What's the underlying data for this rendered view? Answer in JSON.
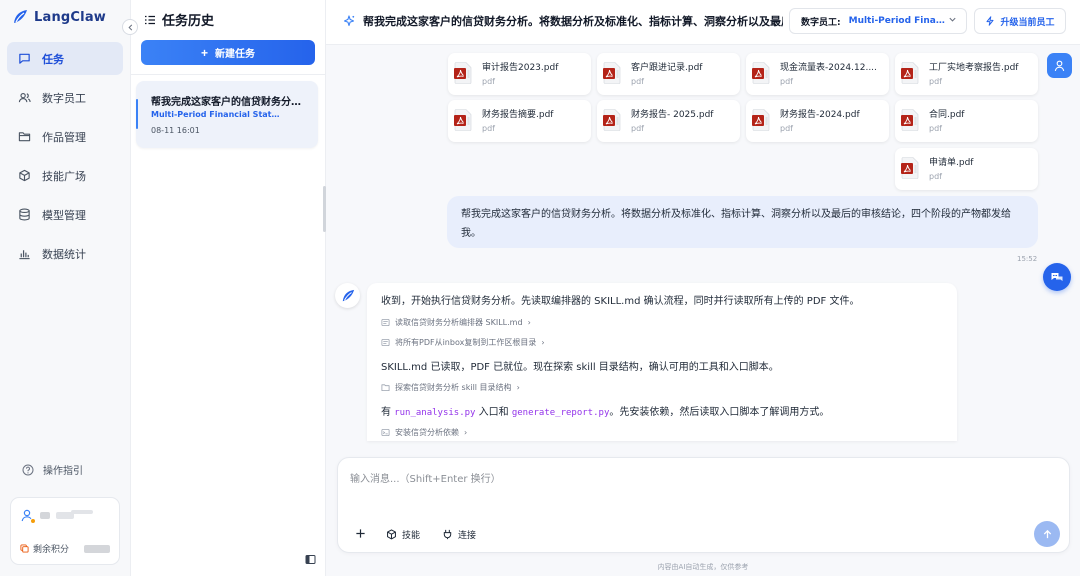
{
  "app": {
    "name": "LangClaw"
  },
  "nav": {
    "items": [
      {
        "label": "任务",
        "icon": "chat-icon",
        "active": true
      },
      {
        "label": "数字员工",
        "icon": "users-icon",
        "active": false
      },
      {
        "label": "作品管理",
        "icon": "folder-icon",
        "active": false
      },
      {
        "label": "技能广场",
        "icon": "cube-icon",
        "active": false
      },
      {
        "label": "模型管理",
        "icon": "database-icon",
        "active": false
      },
      {
        "label": "数据统计",
        "icon": "bar-chart-icon",
        "active": false
      }
    ],
    "guide_label": "操作指引",
    "credits_label": "剩余积分"
  },
  "history": {
    "title": "任务历史",
    "new_task_label": "新建任务",
    "tasks": [
      {
        "title": "帮我完成这家客户的信贷财务分析...",
        "employee": "Multi-Period Financial Statement A...",
        "time": "08-11 16:01"
      }
    ]
  },
  "topbar": {
    "title": "帮我完成这家客户的信贷财务分析。将数据分析及标准化、指标计算、洞察分析以及最后的...",
    "employee_label": "数字员工:",
    "employee_value": "Multi-Period Financi...",
    "upgrade_label": "升级当前员工"
  },
  "files": [
    {
      "name": "审计报告2023.pdf",
      "ext": "pdf"
    },
    {
      "name": "客户跟进记录.pdf",
      "ext": "pdf"
    },
    {
      "name": "现金流量表-2024.12....",
      "ext": "pdf"
    },
    {
      "name": "工厂实地考察报告.pdf",
      "ext": "pdf"
    },
    {
      "name": "财务报告摘要.pdf",
      "ext": "pdf"
    },
    {
      "name": "财务报告- 2025.pdf",
      "ext": "pdf"
    },
    {
      "name": "财务报告-2024.pdf",
      "ext": "pdf"
    },
    {
      "name": "合同.pdf",
      "ext": "pdf"
    },
    {
      "name": "申请单.pdf",
      "ext": "pdf"
    }
  ],
  "user_message": {
    "text": "帮我完成这家客户的信贷财务分析。将数据分析及标准化、指标计算、洞察分析以及最后的审核结论，四个阶段的产物都发给我。",
    "time": "15:52"
  },
  "bot_message": {
    "line1": "收到，开始执行信贷财务分析。先读取编排器的 SKILL.md 确认流程，同时并行读取所有上传的 PDF 文件。",
    "step1": "读取信贷财务分析编排器 SKILL.md",
    "step2": "将所有PDF从inbox复制到工作区根目录",
    "line2": "SKILL.md 已读取，PDF 已就位。现在探索 skill 目录结构，确认可用的工具和入口脚本。",
    "step3": "探索信贷财务分析 skill 目录结构",
    "line3_prefix": "有 ",
    "line3_code1": "run_analysis.py",
    "line3_mid": " 入口和 ",
    "line3_code2": "generate_report.py",
    "line3_suffix": "。先安装依赖，然后读取入口脚本了解调用方式。",
    "step4": "安装信贷分析依赖"
  },
  "composer": {
    "placeholder": "输入消息...（Shift+Enter 换行）",
    "skills_label": "技能",
    "connect_label": "连接"
  },
  "disclaimer": "内容由AI自动生成，仅供参考",
  "colors": {
    "accent": "#2563eb",
    "pdf_red": "#b42318"
  }
}
